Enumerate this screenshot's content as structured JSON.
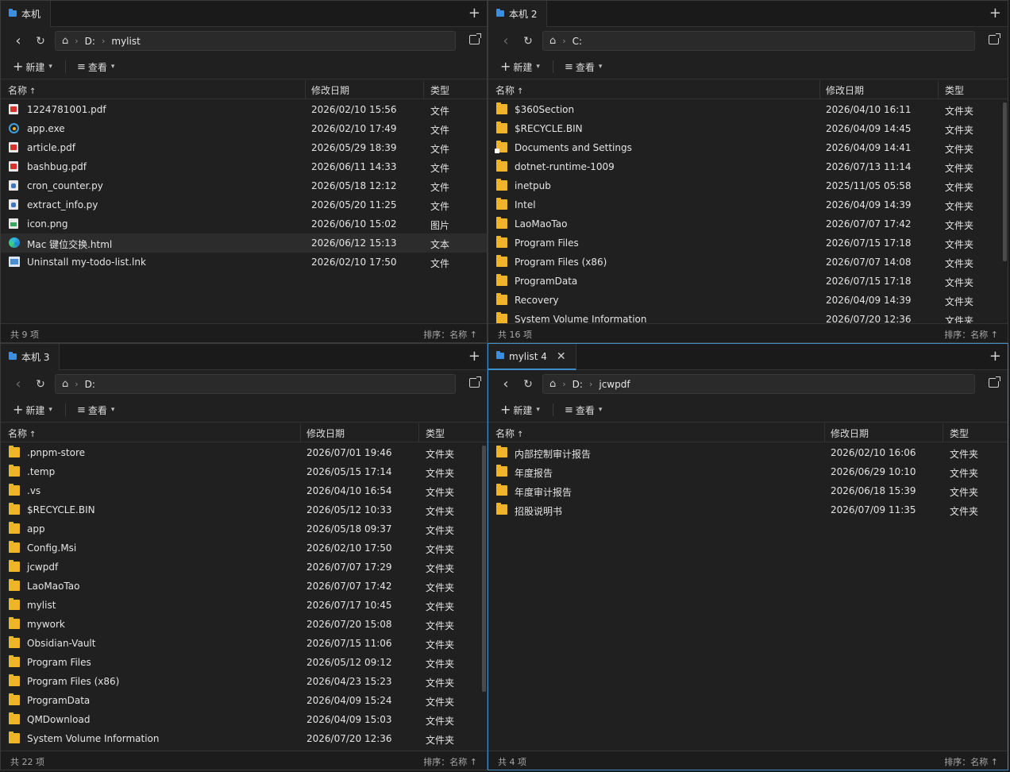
{
  "common": {
    "new_label": "新建",
    "view_label": "查看",
    "col_name": "名称",
    "col_date": "修改日期",
    "col_type": "类型",
    "sort_arrow": "↑",
    "sort_label": "排序：名称 ↑"
  },
  "panes": [
    {
      "tab": "本机",
      "path": [
        "D:",
        "mylist"
      ],
      "status": "共 9 项",
      "rows": [
        {
          "icon": "pdf",
          "name": "1224781001.pdf",
          "date": "2026/02/10 15:56",
          "type": "文件"
        },
        {
          "icon": "exe",
          "name": "app.exe",
          "date": "2026/02/10 17:49",
          "type": "文件"
        },
        {
          "icon": "pdf",
          "name": "article.pdf",
          "date": "2026/05/29 18:39",
          "type": "文件"
        },
        {
          "icon": "pdf",
          "name": "bashbug.pdf",
          "date": "2026/06/11 14:33",
          "type": "文件"
        },
        {
          "icon": "py",
          "name": "cron_counter.py",
          "date": "2026/05/18 12:12",
          "type": "文件"
        },
        {
          "icon": "py",
          "name": "extract_info.py",
          "date": "2026/05/20 11:25",
          "type": "文件"
        },
        {
          "icon": "png",
          "name": "icon.png",
          "date": "2026/06/10 15:02",
          "type": "图片"
        },
        {
          "icon": "html",
          "name": "Mac 键位交换.html",
          "date": "2026/06/12 15:13",
          "type": "文本",
          "selected": true
        },
        {
          "icon": "lnk",
          "name": "Uninstall my-todo-list.lnk",
          "date": "2026/02/10 17:50",
          "type": "文件"
        }
      ]
    },
    {
      "tab": "本机 2",
      "path": [
        "C:"
      ],
      "status": "共 16 项",
      "rows": [
        {
          "icon": "folder",
          "name": "$360Section",
          "date": "2026/04/10 16:11",
          "type": "文件夹"
        },
        {
          "icon": "folder",
          "name": "$RECYCLE.BIN",
          "date": "2026/04/09 14:45",
          "type": "文件夹"
        },
        {
          "icon": "folder-special",
          "name": "Documents and Settings",
          "date": "2026/04/09 14:41",
          "type": "文件夹"
        },
        {
          "icon": "folder",
          "name": "dotnet-runtime-1009",
          "date": "2026/07/13 11:14",
          "type": "文件夹"
        },
        {
          "icon": "folder",
          "name": "inetpub",
          "date": "2025/11/05 05:58",
          "type": "文件夹"
        },
        {
          "icon": "folder",
          "name": "Intel",
          "date": "2026/04/09 14:39",
          "type": "文件夹"
        },
        {
          "icon": "folder",
          "name": "LaoMaoTao",
          "date": "2026/07/07 17:42",
          "type": "文件夹"
        },
        {
          "icon": "folder",
          "name": "Program Files",
          "date": "2026/07/15 17:18",
          "type": "文件夹"
        },
        {
          "icon": "folder",
          "name": "Program Files (x86)",
          "date": "2026/07/07 14:08",
          "type": "文件夹"
        },
        {
          "icon": "folder",
          "name": "ProgramData",
          "date": "2026/07/15 17:18",
          "type": "文件夹"
        },
        {
          "icon": "folder",
          "name": "Recovery",
          "date": "2026/04/09 14:39",
          "type": "文件夹"
        },
        {
          "icon": "folder",
          "name": "System Volume Information",
          "date": "2026/07/20 12:36",
          "type": "文件夹"
        }
      ]
    },
    {
      "tab": "本机 3",
      "path": [
        "D:"
      ],
      "status": "共 22 项",
      "rows": [
        {
          "icon": "folder",
          "name": ".pnpm-store",
          "date": "2026/07/01 19:46",
          "type": "文件夹"
        },
        {
          "icon": "folder",
          "name": ".temp",
          "date": "2026/05/15 17:14",
          "type": "文件夹"
        },
        {
          "icon": "folder",
          "name": ".vs",
          "date": "2026/04/10 16:54",
          "type": "文件夹"
        },
        {
          "icon": "folder",
          "name": "$RECYCLE.BIN",
          "date": "2026/05/12 10:33",
          "type": "文件夹"
        },
        {
          "icon": "folder",
          "name": "app",
          "date": "2026/05/18 09:37",
          "type": "文件夹"
        },
        {
          "icon": "folder",
          "name": "Config.Msi",
          "date": "2026/02/10 17:50",
          "type": "文件夹"
        },
        {
          "icon": "folder",
          "name": "jcwpdf",
          "date": "2026/07/07 17:29",
          "type": "文件夹"
        },
        {
          "icon": "folder",
          "name": "LaoMaoTao",
          "date": "2026/07/07 17:42",
          "type": "文件夹"
        },
        {
          "icon": "folder",
          "name": "mylist",
          "date": "2026/07/17 10:45",
          "type": "文件夹"
        },
        {
          "icon": "folder",
          "name": "mywork",
          "date": "2026/07/20 15:08",
          "type": "文件夹"
        },
        {
          "icon": "folder",
          "name": "Obsidian-Vault",
          "date": "2026/07/15 11:06",
          "type": "文件夹"
        },
        {
          "icon": "folder",
          "name": "Program Files",
          "date": "2026/05/12 09:12",
          "type": "文件夹"
        },
        {
          "icon": "folder",
          "name": "Program Files (x86)",
          "date": "2026/04/23 15:23",
          "type": "文件夹"
        },
        {
          "icon": "folder",
          "name": "ProgramData",
          "date": "2026/04/09 15:24",
          "type": "文件夹"
        },
        {
          "icon": "folder",
          "name": "QMDownload",
          "date": "2026/04/09 15:03",
          "type": "文件夹"
        },
        {
          "icon": "folder",
          "name": "System Volume Information",
          "date": "2026/07/20 12:36",
          "type": "文件夹"
        }
      ]
    },
    {
      "tab": "mylist 4",
      "tab_close": "✕",
      "path": [
        "D:",
        "jcwpdf"
      ],
      "status": "共 4 项",
      "rows": [
        {
          "icon": "folder",
          "name": "内部控制审计报告",
          "date": "2026/02/10 16:06",
          "type": "文件夹"
        },
        {
          "icon": "folder",
          "name": "年度报告",
          "date": "2026/06/29 10:10",
          "type": "文件夹"
        },
        {
          "icon": "folder",
          "name": "年度审计报告",
          "date": "2026/06/18 15:39",
          "type": "文件夹"
        },
        {
          "icon": "folder",
          "name": "招股说明书",
          "date": "2026/07/09 11:35",
          "type": "文件夹"
        }
      ]
    }
  ]
}
